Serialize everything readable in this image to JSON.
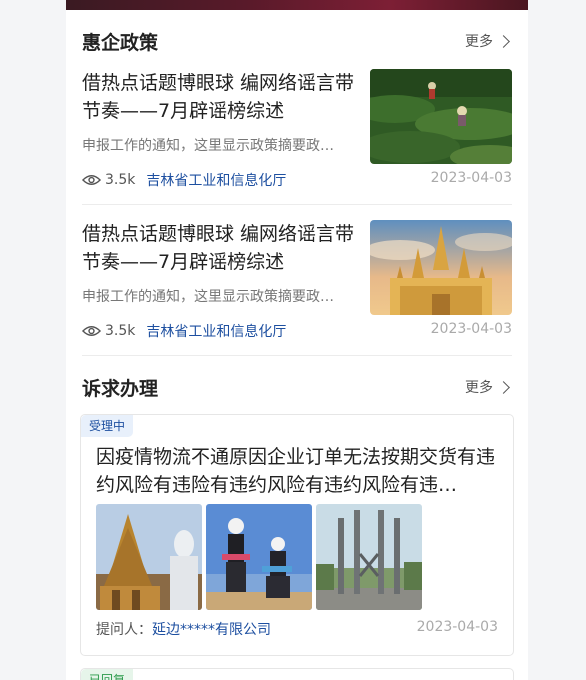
{
  "policy_section": {
    "title": "惠企政策",
    "more_label": "更多"
  },
  "news": [
    {
      "title": "借热点话题博眼球 编网络谣言带节奏——7月辟谣榜综述",
      "summary": "申报工作的通知，这里显示政策摘要政…",
      "views": "3.5k",
      "source": "吉林省工业和信息化厅",
      "date": "2023-04-03"
    },
    {
      "title": "借热点话题博眼球 编网络谣言带节奏——7月辟谣榜综述",
      "summary": "申报工作的通知，这里显示政策摘要政…",
      "views": "3.5k",
      "source": "吉林省工业和信息化厅",
      "date": "2023-04-03"
    }
  ],
  "appeal_section": {
    "title": "诉求办理",
    "more_label": "更多"
  },
  "appeal": {
    "status": "受理中",
    "title": "因疫情物流不通原因企业订单无法按期交货有违约风险有违险有违约风险有违约风险有违…",
    "submitter_label": "提问人：",
    "submitter": "延边*****有限公司",
    "date": "2023-04-03"
  },
  "next_appeal": {
    "status": "已回复"
  },
  "colors": {
    "accent": "#1d4fa0",
    "status_bg": "#e8f0fb",
    "replied": "#2a9a4a"
  }
}
